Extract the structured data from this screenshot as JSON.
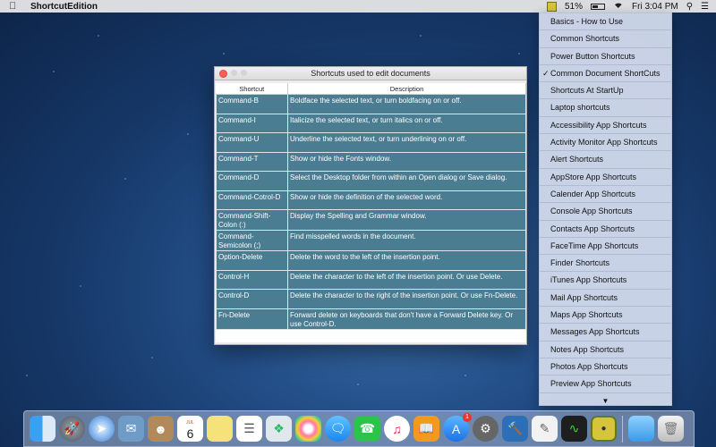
{
  "menubar": {
    "app_name": "ShortcutEdition",
    "battery_percent": "51%",
    "clock": "Fri 3:04 PM"
  },
  "dropdown": {
    "items": [
      {
        "label": "Basics - How to Use",
        "checked": false
      },
      {
        "label": "Common Shortcuts",
        "checked": false
      },
      {
        "label": "Power Button Shortcuts",
        "checked": false
      },
      {
        "label": "Common Document ShortCuts",
        "checked": true
      },
      {
        "label": "Shortcuts At StartUp",
        "checked": false
      },
      {
        "label": "Laptop shortcuts",
        "checked": false
      },
      {
        "label": "Accessibility App Shortcuts",
        "checked": false
      },
      {
        "label": "Activity Monitor App Shortcuts",
        "checked": false
      },
      {
        "label": "Alert Shortcuts",
        "checked": false
      },
      {
        "label": "AppStore App Shortcuts",
        "checked": false
      },
      {
        "label": "Calender App Shortcuts",
        "checked": false
      },
      {
        "label": "Console App Shortcuts",
        "checked": false
      },
      {
        "label": "Contacts App Shortcuts",
        "checked": false
      },
      {
        "label": "FaceTime App Shortcuts",
        "checked": false
      },
      {
        "label": "Finder Shortcuts",
        "checked": false
      },
      {
        "label": "iTunes App Shortcuts",
        "checked": false
      },
      {
        "label": "Mail App Shortcuts",
        "checked": false
      },
      {
        "label": "Maps App Shortcuts",
        "checked": false
      },
      {
        "label": "Messages App Shortcuts",
        "checked": false
      },
      {
        "label": "Notes App Shortcuts",
        "checked": false
      },
      {
        "label": "Photos App Shortcuts",
        "checked": false
      },
      {
        "label": "Preview App Shortcuts",
        "checked": false
      }
    ],
    "more_indicator": "▼"
  },
  "window": {
    "title": "Shortcuts used to edit documents",
    "columns": [
      "Shortcut",
      "Description"
    ],
    "rows": [
      {
        "shortcut": "Command-B",
        "description": "Boldface the selected text, or turn boldfacing on or off."
      },
      {
        "shortcut": "Command-I",
        "description": "Italicize the selected text, or turn italics on or off."
      },
      {
        "shortcut": "Command-U",
        "description": "Underline the selected text, or turn underlining on or off."
      },
      {
        "shortcut": "Command-T",
        "description": "Show or hide the Fonts window."
      },
      {
        "shortcut": "Command-D",
        "description": "Select the Desktop folder from within an Open dialog or Save dialog."
      },
      {
        "shortcut": "Command-Cotrol-D",
        "description": "Show or hide the definition of the selected word."
      },
      {
        "shortcut": "Command-Shift-Colon (:)",
        "description": "Display the Spelling and Grammar window."
      },
      {
        "shortcut": "Command-Semicolon (;)",
        "description": "Find misspelled words in the document."
      },
      {
        "shortcut": "Option-Delete",
        "description": "Delete the word to the left of the insertion point."
      },
      {
        "shortcut": "Control-H",
        "description": "Delete the character to the left of the insertion point. Or use Delete."
      },
      {
        "shortcut": "Control-D",
        "description": "Delete the character to the right of the insertion point. Or use Fn-Delete."
      },
      {
        "shortcut": "Fn-Delete",
        "description": "Forward delete on keyboards that don't have a Forward Delete   key. Or use Control-D."
      }
    ]
  },
  "dock": {
    "calendar_month": "JUL",
    "calendar_day": "6",
    "appstore_badge": "1"
  }
}
